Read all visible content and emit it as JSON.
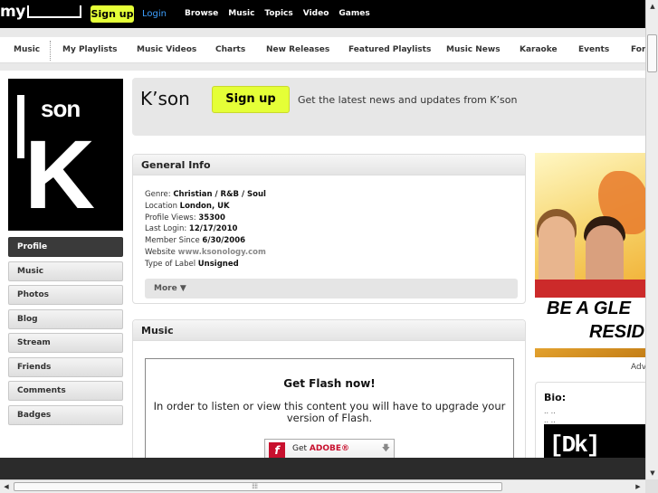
{
  "topbar": {
    "logo": "my",
    "signup_label": "Sign up",
    "login_label": "Login",
    "nav": [
      "Browse",
      "Music",
      "Topics",
      "Video",
      "Games"
    ]
  },
  "subnav": {
    "items": [
      "Music",
      "My Playlists",
      "Music Videos",
      "Charts",
      "New Releases",
      "Featured Playlists",
      "Music News",
      "Karaoke",
      "Events",
      "For"
    ]
  },
  "profile": {
    "pic_son": "son",
    "pic_k": "K",
    "name": "K’son",
    "signup_label": "Sign up",
    "tagline": "Get the latest news and updates from K’son"
  },
  "sidebar": {
    "items": [
      "Profile",
      "Music",
      "Photos",
      "Blog",
      "Stream",
      "Friends",
      "Comments",
      "Badges"
    ]
  },
  "general_info": {
    "title": "General Info",
    "genre_label": "Genre:",
    "genre_value": "Christian / R&B / Soul",
    "location_label": "Location",
    "location_value": "London, UK",
    "views_label": "Profile Views:",
    "views_value": "35300",
    "last_login_label": "Last Login:",
    "last_login_value": "12/17/2010",
    "member_since_label": "Member Since",
    "member_since_value": "6/30/2006",
    "website_label": "Website",
    "website_value": "www.ksonology.com",
    "label_type_label": "Type of Label",
    "label_type_value": "Unsigned",
    "more_label": "More ▼"
  },
  "music": {
    "title": "Music",
    "flash_title": "Get Flash now!",
    "flash_text": "In order to listen or view this content you will have to upgrade your version of Flash.",
    "flash_badge_get": "Get",
    "flash_badge_adobe": "ADOBE®",
    "flash_badge_f": "f"
  },
  "ad": {
    "line1": "BE A GLE",
    "line2": "RESID",
    "label": "Adv"
  },
  "bio": {
    "title": "Bio:",
    "line1": ".. ..",
    "line2": ".. ..",
    "img_text": "[Dk]"
  },
  "scroll": {
    "up": "▲",
    "down": "▼",
    "left": "◀",
    "right": "▶",
    "grip": "⁞⁞⁞⁞"
  }
}
